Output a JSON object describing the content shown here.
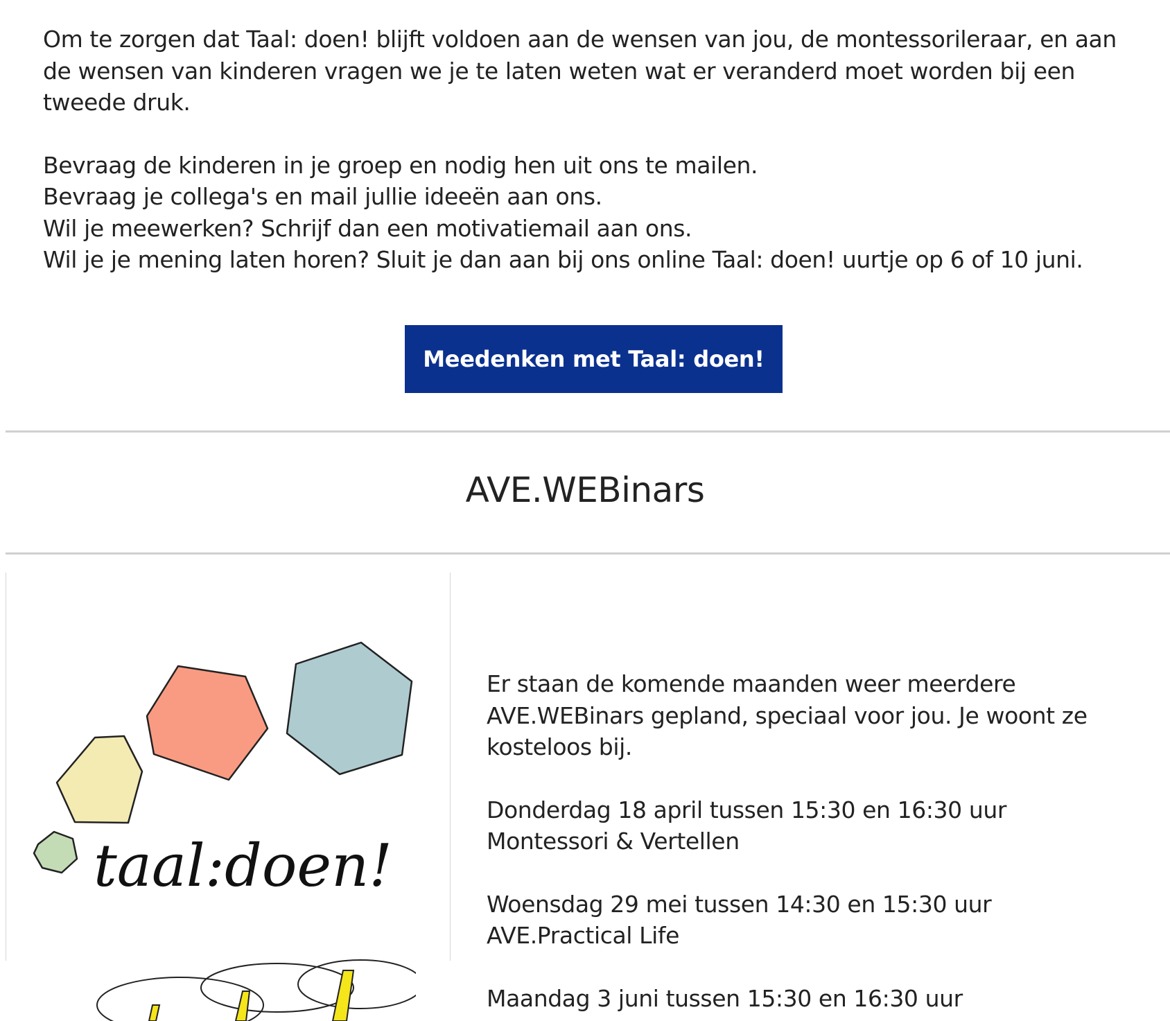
{
  "intro": {
    "paragraph": "Om te zorgen dat Taal: doen! blijft voldoen aan de wensen van jou, de montessorileraar, en aan de wensen van kinderen vragen we je te laten weten wat er veranderd moet worden bij een tweede druk.",
    "lines": [
      "Bevraag de kinderen in je groep en nodig hen uit ons te mailen.",
      "Bevraag je collega's en mail jullie ideeën aan ons.",
      "Wil je meewerken? Schrijf dan een motivatiemail aan ons.",
      "Wil je je mening laten horen? Sluit je dan aan bij ons online Taal: doen! uurtje op 6 of 10 juni."
    ]
  },
  "cta": {
    "label": "Meedenken met Taal: doen!"
  },
  "section": {
    "title": "AVE.WEBinars"
  },
  "logo": {
    "text": "taal:doen!",
    "shape_colors": [
      "#f3ebb2",
      "#f99b82",
      "#aecbd0",
      "#c4dcb6"
    ]
  },
  "webinars": {
    "intro": "Er staan de komende maanden weer meerdere AVE.WEBinars gepland, speciaal voor jou. Je woont ze kosteloos bij.",
    "items": [
      {
        "when": "Donderdag 18 april tussen 15:30 en 16:30 uur",
        "topic": "Montessori & Vertellen"
      },
      {
        "when": "Woensdag 29 mei tussen 14:30 en 15:30 uur",
        "topic": "AVE.Practical Life"
      },
      {
        "when": "Maandag 3 juni tussen 15:30 en 16:30 uur",
        "topic": ""
      }
    ]
  },
  "colors": {
    "button_bg": "#0b318f",
    "button_text": "#ffffff",
    "rule": "#d0d0d0",
    "text": "#222222"
  }
}
